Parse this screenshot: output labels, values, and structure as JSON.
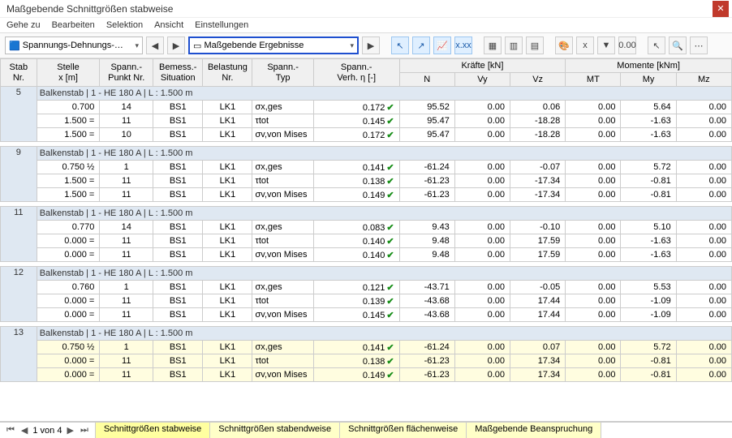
{
  "window": {
    "title": "Maßgebende Schnittgrößen stabweise"
  },
  "menu": {
    "gehe_zu": "Gehe zu",
    "bearbeiten": "Bearbeiten",
    "selektion": "Selektion",
    "ansicht": "Ansicht",
    "einstellungen": "Einstellungen"
  },
  "toolbar": {
    "combo1": "Spannungs-Dehnungs-…",
    "combo2": "Maßgebende Ergebnisse"
  },
  "headers": {
    "stab": "Stab\nNr.",
    "stelle": "Stelle\nx [m]",
    "punkt": "Spann.-\nPunkt Nr.",
    "bemess": "Bemess.-\nSituation",
    "bel": "Belastung\nNr.",
    "typ": "Spann.-\nTyp",
    "verh": "Spann.-\nVerh. η [-]",
    "kraefte": "Kräfte [kN]",
    "momente": "Momente [kNm]",
    "N": "N",
    "Vy": "Vy",
    "Vz": "Vz",
    "MT": "MT",
    "My": "My",
    "Mz": "Mz"
  },
  "groups": [
    {
      "stab": "5",
      "hdr": "Balkenstab | 1 - HE 180 A | L : 1.500 m",
      "rows": [
        {
          "x": "0.700",
          "p": "14",
          "b": "BS1",
          "l": "LK1",
          "t": "σx,ges",
          "v": "0.172",
          "N": "95.52",
          "Vy": "0.00",
          "Vz": "0.06",
          "MT": "0.00",
          "My": "5.64",
          "Mz": "0.00"
        },
        {
          "x": "1.500 =",
          "p": "11",
          "b": "BS1",
          "l": "LK1",
          "t": "τtot",
          "v": "0.145",
          "N": "95.47",
          "Vy": "0.00",
          "Vz": "-18.28",
          "MT": "0.00",
          "My": "-1.63",
          "Mz": "0.00"
        },
        {
          "x": "1.500 =",
          "p": "10",
          "b": "BS1",
          "l": "LK1",
          "t": "σv,von Mises",
          "v": "0.172",
          "N": "95.47",
          "Vy": "0.00",
          "Vz": "-18.28",
          "MT": "0.00",
          "My": "-1.63",
          "Mz": "0.00"
        }
      ]
    },
    {
      "stab": "9",
      "hdr": "Balkenstab | 1 - HE 180 A | L : 1.500 m",
      "rows": [
        {
          "x": "0.750 ½",
          "p": "1",
          "b": "BS1",
          "l": "LK1",
          "t": "σx,ges",
          "v": "0.141",
          "N": "-61.24",
          "Vy": "0.00",
          "Vz": "-0.07",
          "MT": "0.00",
          "My": "5.72",
          "Mz": "0.00"
        },
        {
          "x": "1.500 =",
          "p": "11",
          "b": "BS1",
          "l": "LK1",
          "t": "τtot",
          "v": "0.138",
          "N": "-61.23",
          "Vy": "0.00",
          "Vz": "-17.34",
          "MT": "0.00",
          "My": "-0.81",
          "Mz": "0.00"
        },
        {
          "x": "1.500 =",
          "p": "11",
          "b": "BS1",
          "l": "LK1",
          "t": "σv,von Mises",
          "v": "0.149",
          "N": "-61.23",
          "Vy": "0.00",
          "Vz": "-17.34",
          "MT": "0.00",
          "My": "-0.81",
          "Mz": "0.00"
        }
      ]
    },
    {
      "stab": "11",
      "hdr": "Balkenstab | 1 - HE 180 A | L : 1.500 m",
      "rows": [
        {
          "x": "0.770",
          "p": "14",
          "b": "BS1",
          "l": "LK1",
          "t": "σx,ges",
          "v": "0.083",
          "N": "9.43",
          "Vy": "0.00",
          "Vz": "-0.10",
          "MT": "0.00",
          "My": "5.10",
          "Mz": "0.00"
        },
        {
          "x": "0.000 =",
          "p": "11",
          "b": "BS1",
          "l": "LK1",
          "t": "τtot",
          "v": "0.140",
          "N": "9.48",
          "Vy": "0.00",
          "Vz": "17.59",
          "MT": "0.00",
          "My": "-1.63",
          "Mz": "0.00"
        },
        {
          "x": "0.000 =",
          "p": "11",
          "b": "BS1",
          "l": "LK1",
          "t": "σv,von Mises",
          "v": "0.140",
          "N": "9.48",
          "Vy": "0.00",
          "Vz": "17.59",
          "MT": "0.00",
          "My": "-1.63",
          "Mz": "0.00"
        }
      ]
    },
    {
      "stab": "12",
      "hdr": "Balkenstab | 1 - HE 180 A | L : 1.500 m",
      "rows": [
        {
          "x": "0.760",
          "p": "1",
          "b": "BS1",
          "l": "LK1",
          "t": "σx,ges",
          "v": "0.121",
          "N": "-43.71",
          "Vy": "0.00",
          "Vz": "-0.05",
          "MT": "0.00",
          "My": "5.53",
          "Mz": "0.00"
        },
        {
          "x": "0.000 =",
          "p": "11",
          "b": "BS1",
          "l": "LK1",
          "t": "τtot",
          "v": "0.139",
          "N": "-43.68",
          "Vy": "0.00",
          "Vz": "17.44",
          "MT": "0.00",
          "My": "-1.09",
          "Mz": "0.00"
        },
        {
          "x": "0.000 =",
          "p": "11",
          "b": "BS1",
          "l": "LK1",
          "t": "σv,von Mises",
          "v": "0.145",
          "N": "-43.68",
          "Vy": "0.00",
          "Vz": "17.44",
          "MT": "0.00",
          "My": "-1.09",
          "Mz": "0.00"
        }
      ]
    },
    {
      "stab": "13",
      "hdr": "Balkenstab | 1 - HE 180 A | L : 1.500 m",
      "highlight": true,
      "rows": [
        {
          "x": "0.750 ½",
          "p": "1",
          "b": "BS1",
          "l": "LK1",
          "t": "σx,ges",
          "v": "0.141",
          "N": "-61.24",
          "Vy": "0.00",
          "Vz": "0.07",
          "MT": "0.00",
          "My": "5.72",
          "Mz": "0.00"
        },
        {
          "x": "0.000 =",
          "p": "11",
          "b": "BS1",
          "l": "LK1",
          "t": "τtot",
          "v": "0.138",
          "N": "-61.23",
          "Vy": "0.00",
          "Vz": "17.34",
          "MT": "0.00",
          "My": "-0.81",
          "Mz": "0.00"
        },
        {
          "x": "0.000 =",
          "p": "11",
          "b": "BS1",
          "l": "LK1",
          "t": "σv,von Mises",
          "v": "0.149",
          "N": "-61.23",
          "Vy": "0.00",
          "Vz": "17.34",
          "MT": "0.00",
          "My": "-0.81",
          "Mz": "0.00"
        }
      ]
    }
  ],
  "footer": {
    "pager": "1 von 4",
    "tabs": [
      "Schnittgrößen stabweise",
      "Schnittgrößen stabendweise",
      "Schnittgrößen flächenweise",
      "Maßgebende Beanspruchung"
    ]
  }
}
